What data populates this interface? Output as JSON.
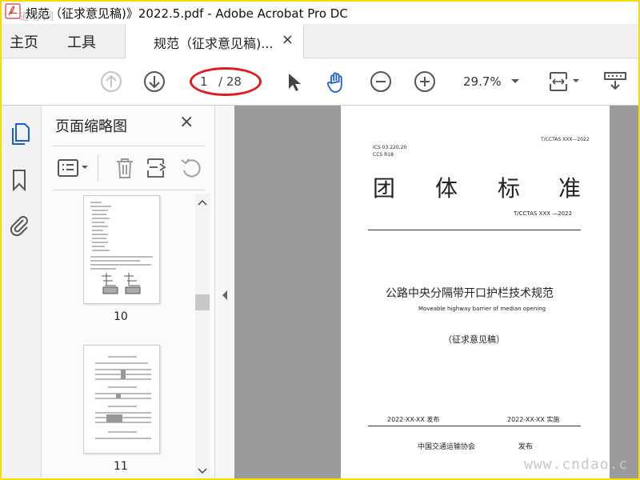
{
  "window": {
    "title": "规范（征求意见稿)》2022.5.pdf - Adobe Acrobat Pro DC",
    "watermark_top": "道标网",
    "watermark_bottom": "www.cndao.c"
  },
  "menubar": {
    "home": "主页",
    "tools": "工具"
  },
  "tab": {
    "label": "规范（征求意见稿)...",
    "close": "×"
  },
  "toolbar": {
    "current_page": "1",
    "total_pages": "/ 28",
    "zoom": "29.7%",
    "highlight_color": "#e01b1b",
    "accent": "#1b5fcf"
  },
  "thumbnails_panel": {
    "title": "页面缩略图",
    "close": "×",
    "thumbs": [
      {
        "label": "10"
      },
      {
        "label": "11"
      }
    ]
  },
  "document": {
    "ics": "ICS 03.220.20",
    "ccs": "CCS R18",
    "std_code_top": "T/CCTAS XXX—2022",
    "std_type": [
      "团",
      "体",
      "标",
      "准"
    ],
    "std_code": "T/CCTAS XXX —2022",
    "title_cn": "公路中央分隔带开口护栏技术规范",
    "title_en": "Moveable highway barrier of median opening",
    "draft": "（征求意见稿）",
    "publish_date": "2022-XX-XX  发布",
    "implement_date": "2022-XX-XX  实施",
    "publisher": "中国交通运输协会",
    "publish_word": "发布"
  }
}
